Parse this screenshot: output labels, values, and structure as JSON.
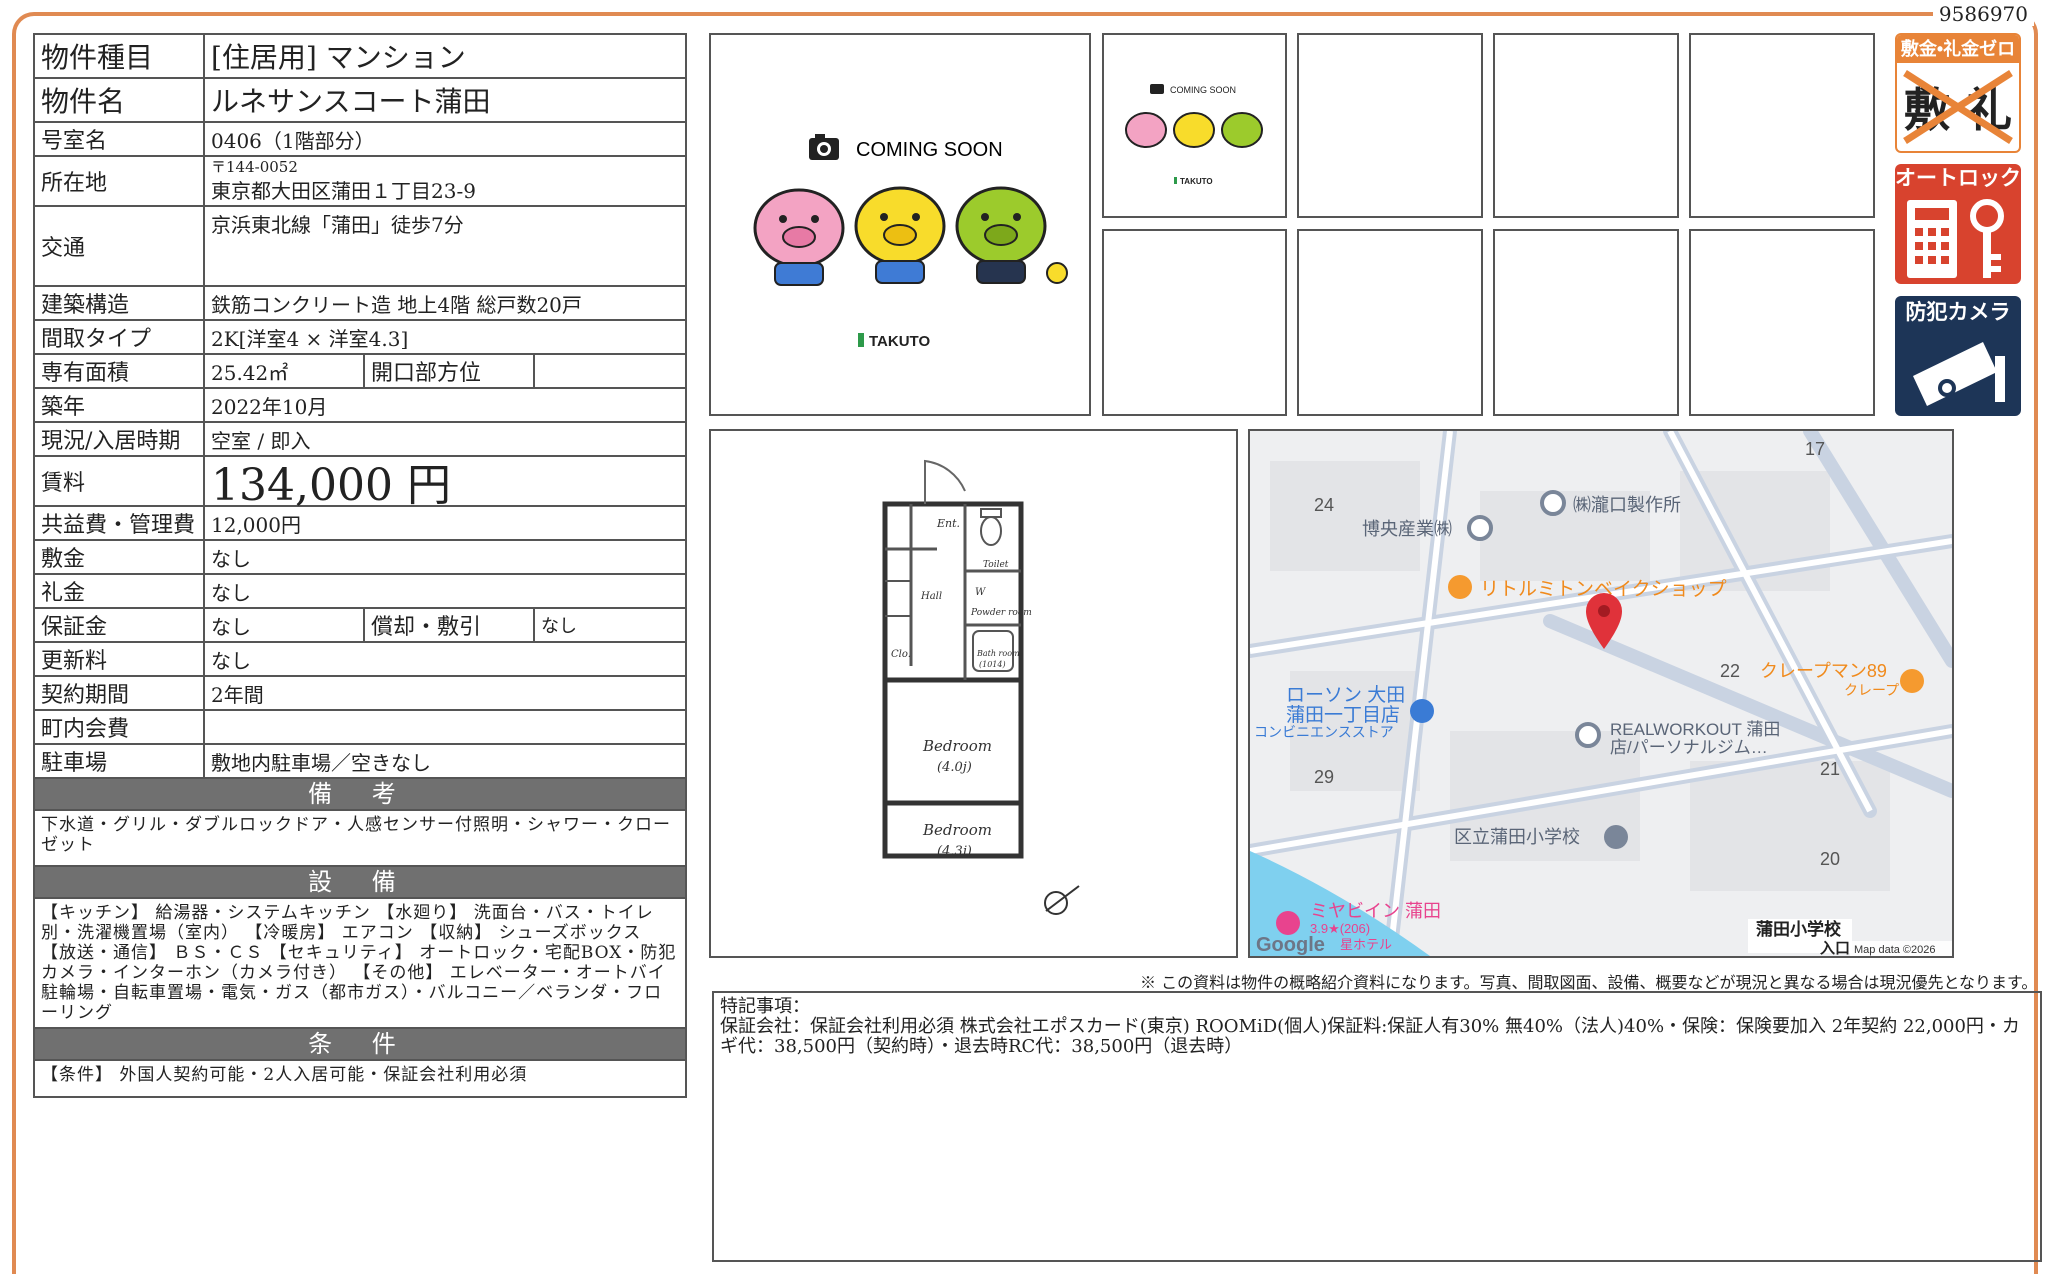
{
  "doc_id": "9586970",
  "spec": {
    "type_label": "物件種目",
    "type_value": "[住居用]  マンション",
    "name_label": "物件名",
    "name_value": "ルネサンスコート蒲田",
    "room_label": "号室名",
    "room_value": "0406（1階部分）",
    "address_label": "所在地",
    "address_zip": "〒144-0052",
    "address_value": "東京都大田区蒲田１丁目23-9",
    "access_label": "交通",
    "access_value": "京浜東北線「蒲田」徒歩7分",
    "structure_label": "建築構造",
    "structure_value": "鉄筋コンクリート造  地上4階  総戸数20戸",
    "layout_label": "間取タイプ",
    "layout_value": "2K[洋室4 × 洋室4.3]",
    "area_label": "専有面積",
    "area_value": "25.42㎡",
    "direction_label": "開口部方位",
    "direction_value": "",
    "built_label": "築年",
    "built_value": "2022年10月",
    "status_label": "現況/入居時期",
    "status_value": "空室 / 即入",
    "rent_label": "賃料",
    "rent_value": "134,000 円",
    "fee_label": "共益費・管理費",
    "fee_value": "12,000円",
    "deposit_label": "敷金",
    "deposit_value": "なし",
    "keymoney_label": "礼金",
    "keymoney_value": "なし",
    "guarantee_label": "保証金",
    "guarantee_value": "なし",
    "amort_label": "償却・敷引",
    "amort_value": "なし",
    "renewal_label": "更新料",
    "renewal_value": "なし",
    "term_label": "契約期間",
    "term_value": "2年間",
    "assoc_label": "町内会費",
    "assoc_value": "",
    "parking_label": "駐車場",
    "parking_value": "敷地内駐車場／空きなし"
  },
  "remarks": {
    "title": "備 考",
    "body": "下水道・グリル・ダブルロックドア・人感センサー付照明・シャワー・クローゼット"
  },
  "equipment": {
    "title": "設 備",
    "body": "【キッチン】 給湯器・システムキッチン 【水廻り】 洗面台・バス・トイレ別・洗濯機置場（室内） 【冷暖房】 エアコン 【収納】 シューズボックス 【放送・通信】 ＢＳ・ＣＳ 【セキュリティ】 オートロック・宅配BOX・防犯カメラ・インターホン（カメラ付き） 【その他】 エレベーター・オートバイ駐輪場・自転車置場・電気・ガス（都市ガス）・バルコニー／ベランダ・フローリング"
  },
  "conditions": {
    "title": "条 件",
    "body": "【条件】 外国人契約可能・2人入居可能・保証会社利用必須"
  },
  "photos": {
    "coming_soon": "COMING SOON",
    "brand": "TAKUTO"
  },
  "floorplan": {
    "ent": "Ent.",
    "toilet": "Toilet",
    "hall": "Hall",
    "w": "W",
    "powder": "Powder room",
    "bath": "Bath room",
    "bath_size": "(1014)",
    "clo": "Clo.",
    "bed1": "Bedroom",
    "bed1_size": "(4.0j)",
    "bed2": "Bedroom",
    "bed2_size": "(4.3j)"
  },
  "map": {
    "labels": [
      "17",
      "24",
      "22",
      "21",
      "29",
      "20"
    ],
    "places": [
      "㈱瀧口製作所",
      "博央産業㈱",
      "リトルミトンベイクショップ",
      "クレープマン89",
      "クレープ",
      "ローソン 大田",
      "蒲田一丁目店",
      "コンビニエンスストア",
      "REALWORKOUT 蒲田",
      "店/パーソナルジム…",
      "区立蒲田小学校",
      "ミヤビイン 蒲田",
      "3.9★(206)",
      "星ホテル",
      "蒲田小学校",
      "入口"
    ],
    "google": "Google",
    "attribution": "Map data ©2026"
  },
  "badges": {
    "zero_title": "敷金•礼金ゼロ",
    "zero_chars": "敷 礼",
    "autolock": "オートロック",
    "camera": "防犯カメラ"
  },
  "notice": "※ この資料は物件の概略紹介資料になります。写真、間取図面、設備、概要などが現況と異なる場合は現況優先となります。",
  "memo": {
    "title": "特記事項：",
    "body": "保証会社：保証会社利用必須 株式会社エポスカード(東京)  ROOMiD(個人)保証料:保証人有30% 無40%（法人)40%・保険：保険要加入 2年契約 22,000円・カギ代：38,500円（契約時）・退去時RC代：38,500円（退去時）"
  },
  "colors": {
    "frame": "#e08a52",
    "header": "#707070",
    "badge_orange": "#e88438",
    "badge_red": "#d8432e",
    "badge_navy": "#1d3557",
    "map_water": "#7fd0ef",
    "map_pin": "#e0323a"
  }
}
